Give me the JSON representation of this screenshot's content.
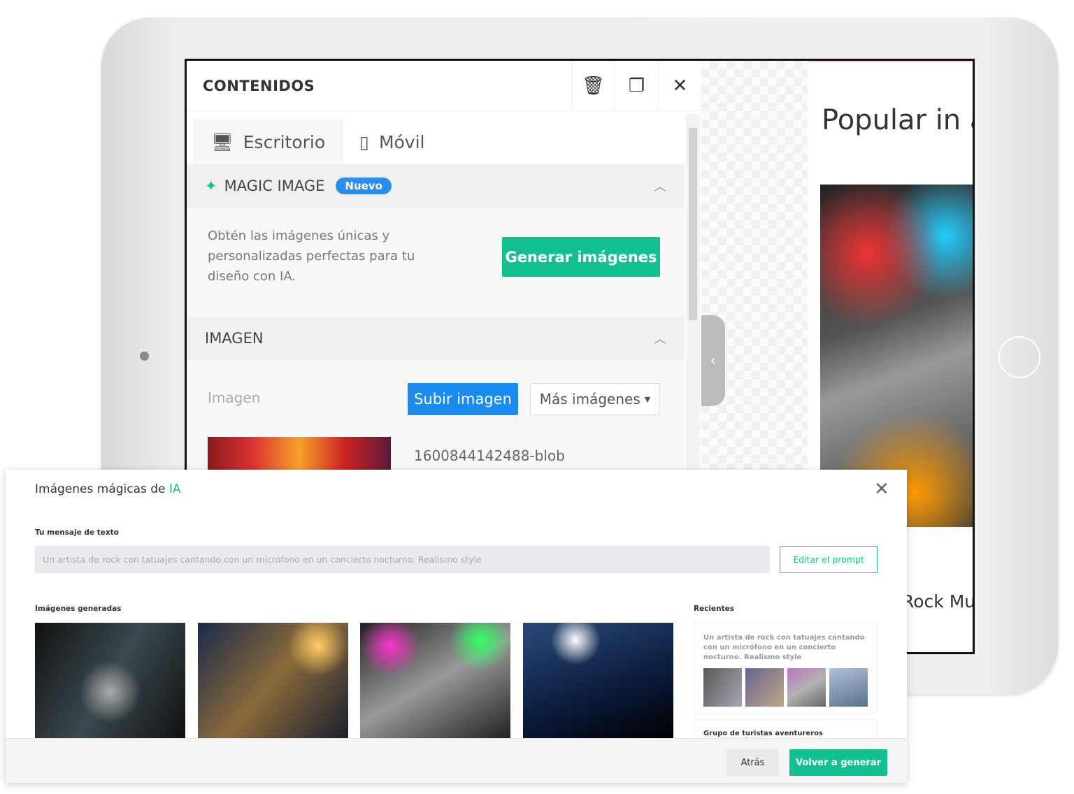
{
  "editor": {
    "title": "CONTENIDOS",
    "icons": [
      "trash-icon",
      "duplicate-icon",
      "close-icon"
    ],
    "tabs": [
      {
        "label": "Escritorio",
        "icon": "desktop-icon"
      },
      {
        "label": "Móvil",
        "icon": "mobile-icon"
      }
    ],
    "magic": {
      "title": "MAGIC IMAGE",
      "badge": "Nuevo",
      "description": "Obtén las imágenes únicas y personalizadas perfectas para tu diseño con IA.",
      "button": "Generar imágenes"
    },
    "image": {
      "title": "IMAGEN",
      "label": "Imagen",
      "upload": "Subir imagen",
      "more": "Más imágenes",
      "filename": "1600844142488-blob"
    }
  },
  "preview": {
    "heading": "Popular in a",
    "caption": "Rock Mus"
  },
  "modal": {
    "title": "Imágenes mágicas de ",
    "title_accent": "IA",
    "prompt_label": "Tu mensaje de texto",
    "prompt_value": "Un artista de rock con tatuajes cantando con un micrófono en un concierto nocturno. Realismo style",
    "edit_button": "Editar el prompt",
    "generated_label": "Imágenes generadas",
    "recent_label": "Recientes",
    "recent": [
      {
        "text": "Un artista de rock con tatuajes cantando con un micrófono en un concierto nocturno. Realismo style"
      },
      {
        "text": "Grupo de turistas aventureros atravesando"
      }
    ],
    "back_button": "Atrás",
    "regenerate_button": "Volver a generar"
  },
  "colors": {
    "accent": "#13c08f",
    "primary": "#1a8cf0"
  }
}
